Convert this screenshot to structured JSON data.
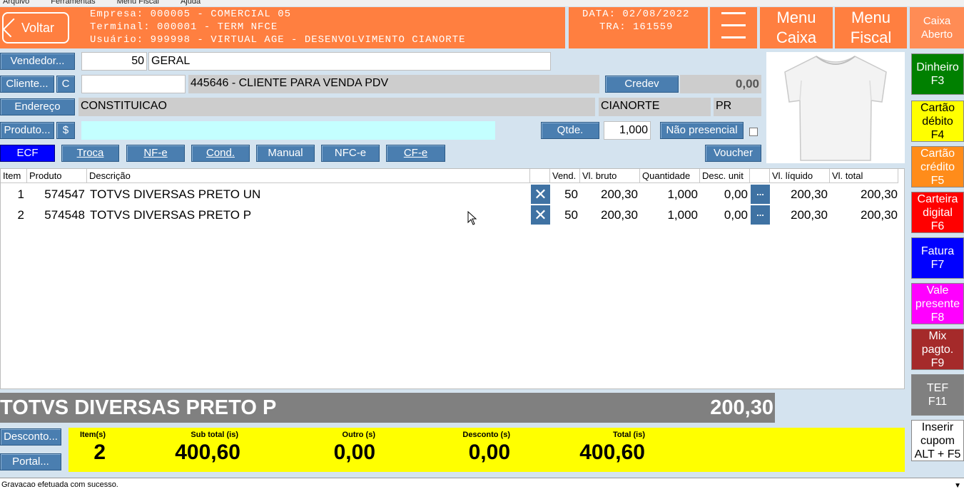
{
  "menubar": [
    "Arquivo",
    "Ferramentas",
    "Menu Fiscal",
    "Ajuda"
  ],
  "header": {
    "back_label": "Voltar",
    "empresa": "Empresa: 000005 - COMERCIAL 05",
    "terminal": "Terminal: 000001 - TERM NFCE",
    "usuario": "Usuário: 999998 - VIRTUAL AGE - DESENVOLVIMENTO CIANORTE",
    "data": "DATA: 02/08/2022",
    "tra": "TRA: 161559",
    "menu_caixa": "Menu Caixa",
    "menu_caixa_1": "Menu",
    "menu_caixa_2": "Caixa",
    "menu_fiscal_1": "Menu",
    "menu_fiscal_2": "Fiscal",
    "caixa_1": "Caixa",
    "caixa_2": "Aberto"
  },
  "form": {
    "vendedor_btn": "Vendedor...",
    "vendedor_code": "50",
    "vendedor_name": "GERAL",
    "cliente_btn": "Cliente...",
    "cliente_c": "C",
    "cliente_input": "",
    "cliente_name": "445646 - CLIENTE PARA VENDA PDV",
    "credev_btn": "Credev",
    "credev_value": "0,00",
    "endereco_btn": "Endereço",
    "endereco": "CONSTITUICAO",
    "cidade": "CIANORTE",
    "uf": "PR",
    "produto_btn": "Produto...",
    "produto_dollar": "$",
    "produto_input": "",
    "qtde_btn": "Qtde.",
    "qtde_value": "1,000",
    "nao_presencial": "Não presencial",
    "voucher_btn": "Voucher"
  },
  "tabs": [
    "ECF",
    "Troca",
    "NF-e",
    "Cond.",
    "Manual",
    "NFC-e",
    "CF-e"
  ],
  "table": {
    "headers": [
      "Item",
      "Produto",
      "Descrição",
      "",
      "Vend.",
      "Vl. bruto",
      "Quantidade",
      "Desc. unit",
      "",
      "Vl. líquido",
      "Vl. total"
    ],
    "rows": [
      {
        "item": "1",
        "produto": "574547",
        "descricao": "TOTVS DIVERSAS PRETO UN",
        "vend": "50",
        "bruto": "200,30",
        "qtd": "1,000",
        "desc": "0,00",
        "liquido": "200,30",
        "total": "200,30"
      },
      {
        "item": "2",
        "produto": "574548",
        "descricao": "TOTVS DIVERSAS PRETO P",
        "vend": "50",
        "bruto": "200,30",
        "qtd": "1,000",
        "desc": "0,00",
        "liquido": "200,30",
        "total": "200,30"
      }
    ]
  },
  "current": {
    "name": "TOTVS DIVERSAS PRETO P",
    "value": "200,30"
  },
  "footer": {
    "desconto_btn": "Desconto...",
    "portal_btn": "Portal...",
    "itens_label": "Item(s)",
    "itens": "2",
    "subtotal_label": "Sub total (is)",
    "subtotal": "400,60",
    "outro_label": "Outro (s)",
    "outro": "0,00",
    "desconto_label": "Desconto (s)",
    "desconto": "0,00",
    "total_label": "Total (is)",
    "total": "400,60"
  },
  "payments": [
    {
      "l1": "Dinheiro",
      "l2": "F3",
      "bg": "#008000",
      "fg": "#ffffff"
    },
    {
      "l1": "Cartão débito",
      "l2": "F4",
      "bg": "#ffff00",
      "fg": "#000000"
    },
    {
      "l1": "Cartão crédito",
      "l2": "F5",
      "bg": "#ff8c1a",
      "fg": "#ffffff"
    },
    {
      "l1": "Carteira digital",
      "l2": "F6",
      "bg": "#ff0000",
      "fg": "#ffffff"
    },
    {
      "l1": "Fatura",
      "l2": "F7",
      "bg": "#0000ff",
      "fg": "#ffffff"
    },
    {
      "l1": "Vale presente",
      "l2": "F8",
      "bg": "#ff00ff",
      "fg": "#ffffff"
    },
    {
      "l1": "Mix pagto.",
      "l2": "F9",
      "bg": "#a52a2a",
      "fg": "#ffffff"
    },
    {
      "l1": "TEF",
      "l2": "F11",
      "bg": "#808080",
      "fg": "#ffffff"
    },
    {
      "l1": "Inserir cupom",
      "l2": "ALT + F5",
      "bg": "#ffffff",
      "fg": "#000000"
    }
  ],
  "status": "Gravacao efetuada com sucesso."
}
